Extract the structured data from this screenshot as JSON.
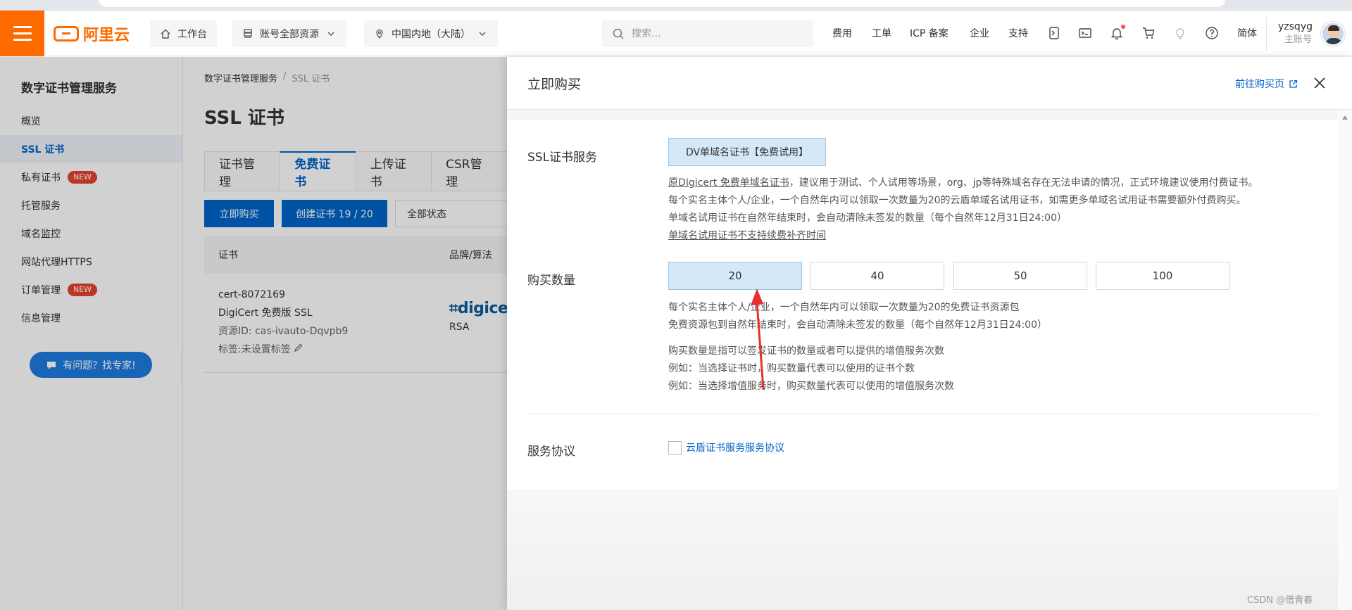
{
  "header": {
    "logo_text": "阿里云",
    "workbench": "工作台",
    "resources": "账号全部资源",
    "region": "中国内地（大陆）",
    "search_placeholder": "搜索...",
    "links": [
      "费用",
      "工单",
      "ICP 备案",
      "企业",
      "支持"
    ],
    "lang": "简体",
    "user_name": "yzsqyg",
    "user_role": "主账号"
  },
  "sidebar": {
    "title": "数字证书管理服务",
    "items": [
      {
        "label": "概览",
        "badge": ""
      },
      {
        "label": "SSL 证书",
        "badge": ""
      },
      {
        "label": "私有证书",
        "badge": "NEW"
      },
      {
        "label": "托管服务",
        "badge": ""
      },
      {
        "label": "域名监控",
        "badge": ""
      },
      {
        "label": "网站代理HTTPS",
        "badge": ""
      },
      {
        "label": "订单管理",
        "badge": "NEW"
      },
      {
        "label": "信息管理",
        "badge": ""
      }
    ],
    "expert_button": "有问题？找专家!"
  },
  "main": {
    "breadcrumb": [
      "数字证书管理服务",
      "/",
      "SSL 证书"
    ],
    "title": "SSL 证书",
    "tabs": [
      "证书管理",
      "免费证书",
      "上传证书",
      "CSR管理"
    ],
    "buy_button": "立即购买",
    "create_button": "创建证书 19 / 20",
    "status_select": "全部状态",
    "columns": [
      "证书",
      "品牌/算法"
    ],
    "row": {
      "cert_name": "cert-8072169",
      "cert_type": "DigiCert 免费版 SSL",
      "resource_id": "资源ID: cas-ivauto-Dqvpb9",
      "tag": "标签:未设置标签",
      "brand": "digicert",
      "algorithm": "RSA"
    }
  },
  "drawer": {
    "title": "立即购买",
    "goto_link": "前往购买页",
    "ssl_label": "SSL证书服务",
    "ssl_option": "DV单域名证书【免费试用】",
    "ssl_desc": {
      "line1_link": "原DIgicert 免费单域名证书",
      "line1_rest": "，建议用于测试、个人试用等场景，org、jp等特殊域名存在无法申请的情况，正式环境建议使用付费证书。",
      "line2": "每个实名主体个人/企业，一个自然年内可以领取一次数量为20的云盾单域名试用证书，如需更多单域名试用证书需要额外付费购买。",
      "line3": "单域名试用证书在自然年结束时，会自动清除未签发的数量（每个自然年12月31日24:00）",
      "line4_link": "单域名试用证书不支持续费补齐时间"
    },
    "qty_label": "购买数量",
    "qty_options": [
      "20",
      "40",
      "50",
      "100"
    ],
    "qty_selected": "20",
    "qty_desc": [
      "每个实名主体个人/企业，一个自然年内可以领取一次数量为20的免费证书资源包",
      "免费资源包到自然年结束时，会自动清除未签发的数量（每个自然年12月31日24:00）"
    ],
    "qty_notes": [
      "购买数量是指可以签发证书的数量或者可以提供的增值服务次数",
      "例如：当选择证书时，购买数量代表可以使用的证书个数",
      "例如：当选择增值服务时，购买数量代表可以使用的增值服务次数"
    ],
    "agreement_label": "服务协议",
    "agreement_link": "云盾证书服务服务协议"
  },
  "watermark": "CSDN @借青春",
  "colors": {
    "brand_orange": "#ff6a00",
    "primary_blue": "#0064c8",
    "new_badge_red": "#e6432e",
    "annotation_arrow": "#e8312f"
  }
}
